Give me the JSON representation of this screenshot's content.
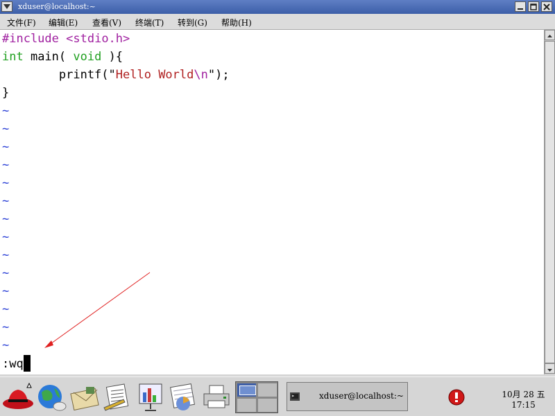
{
  "window": {
    "title": "xduser@localhost:~"
  },
  "menubar": {
    "items": [
      "文件(F)",
      "编辑(E)",
      "查看(V)",
      "终端(T)",
      "转到(G)",
      "帮助(H)"
    ]
  },
  "editor": {
    "line1": {
      "directive": "#include",
      "header": "<stdio.h>"
    },
    "line2": {
      "type1": "int",
      "mid": " main( ",
      "type2": "void",
      "end": " ){"
    },
    "line3": {
      "indent": "        printf(",
      "q1": "\"",
      "str": "Hello World",
      "esc": "\\n",
      "q2": "\"",
      "end": ");"
    },
    "line4": "}",
    "tilde": "~",
    "command": ":wq"
  },
  "panel": {
    "task_label": "xduser@localhost:~",
    "clock_date": "10月 28 五",
    "clock_time": "17:15"
  },
  "colors": {
    "titlebar": "#4a6db5",
    "preprocessor": "#a020a0",
    "type": "#20a020",
    "string": "#b02020",
    "tilde": "#2a3fd6",
    "arrow": "#e02020"
  }
}
